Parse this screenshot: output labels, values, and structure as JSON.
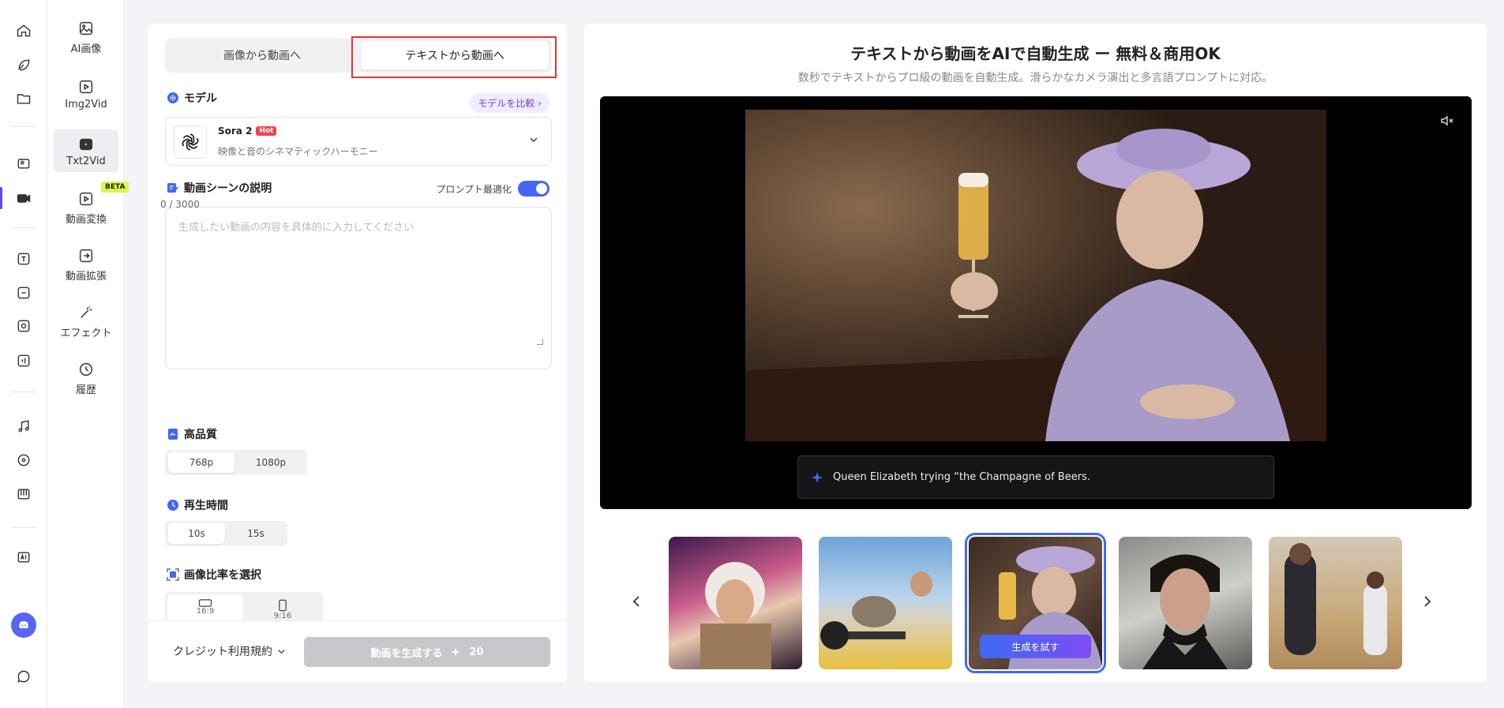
{
  "subnav": {
    "items": [
      {
        "label": "AI画像",
        "icon": "image-icon"
      },
      {
        "label": "Img2Vid",
        "icon": "image-to-video-icon"
      },
      {
        "label": "Txt2Vid",
        "icon": "text-to-video-icon"
      },
      {
        "label": "動画変換",
        "icon": "video-convert-icon"
      },
      {
        "label": "動画拡張",
        "icon": "video-extend-icon"
      },
      {
        "label": "エフェクト",
        "icon": "magic-wand-icon"
      },
      {
        "label": "履歴",
        "icon": "clock-icon"
      }
    ],
    "beta": "BETA"
  },
  "panel": {
    "tabs": [
      "画像から動画へ",
      "テキストから動画へ"
    ],
    "model_title": "モデル",
    "compare_label": "モデルを比較",
    "model": {
      "name": "Sora 2",
      "badge": "Hot",
      "desc": "映像と音のシネマティックハーモニー"
    },
    "scene_title": "動画シーンの説明",
    "optimize_label": "プロンプト最適化",
    "prompt_placeholder": "生成したい動画の内容を具体的に入力してください",
    "prompt_count": "0 / 3000",
    "quality_title": "高品質",
    "quality_options": [
      "768p",
      "1080p"
    ],
    "duration_title": "再生時間",
    "duration_options": [
      "10s",
      "15s"
    ],
    "ratio_title": "画像比率を選択",
    "ratio_options": [
      "16:9",
      "9:16"
    ],
    "credit_terms": "クレジット利用規約",
    "generate_label": "動画を生成する",
    "generate_cost": "20"
  },
  "right": {
    "title": "テキストから動画をAIで自動生成 ー 無料＆商用OK",
    "subtitle": "数秒でテキストからプロ級の動画を自動生成。滑らかなカメラ演出と多言語プロンプトに対応。",
    "caption": "Queen Elizabeth trying “the Champagne of Beers.",
    "try_label": "生成を試す"
  },
  "colors": {
    "accent": "#4466f5",
    "highlight": "#e43333",
    "hot": "#f5414e"
  }
}
